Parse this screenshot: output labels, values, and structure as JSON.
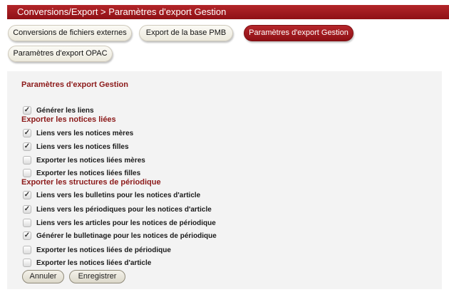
{
  "header": {
    "breadcrumb": "Conversions/Export > Paramètres d'export Gestion"
  },
  "tabs": [
    {
      "label": "Conversions de fichiers externes",
      "active": false
    },
    {
      "label": "Export de la base PMB",
      "active": false
    },
    {
      "label": "Paramètres d'export Gestion",
      "active": true
    },
    {
      "label": "Paramètres d'export OPAC",
      "active": false
    }
  ],
  "form": {
    "title": "Paramètres d'export Gestion",
    "generate_links": {
      "label": "Générer les liens",
      "checked": true
    },
    "groups": [
      {
        "title": "Exporter les notices liées",
        "options": [
          {
            "label": "Liens vers les notices mères",
            "checked": true
          },
          {
            "label": "Liens vers les notices filles",
            "checked": true
          },
          {
            "label": "Exporter les notices liées mères",
            "checked": false
          },
          {
            "label": "Exporter les notices liées filles",
            "checked": false
          }
        ]
      },
      {
        "title": "Exporter les structures de périodique",
        "options": [
          {
            "label": "Liens vers les bulletins pour les notices d'article",
            "checked": true
          },
          {
            "label": "Liens vers les périodiques pour les notices d'article",
            "checked": true
          },
          {
            "label": "Liens vers les articles pour les notices de périodique",
            "checked": false
          },
          {
            "label": "Générer le bulletinage pour les notices de périodique",
            "checked": true
          },
          {
            "label": "Exporter les notices liées de périodique",
            "checked": false
          },
          {
            "label": "Exporter les notices liées d'article",
            "checked": false
          }
        ]
      }
    ],
    "buttons": {
      "cancel": "Annuler",
      "save": "Enregistrer"
    }
  },
  "colors": {
    "accent": "#9e1a1f",
    "section_title": "#8c1a1a",
    "panel_bg": "#f3f3f3"
  },
  "icons": {
    "checkbox_mark": "check-icon"
  }
}
